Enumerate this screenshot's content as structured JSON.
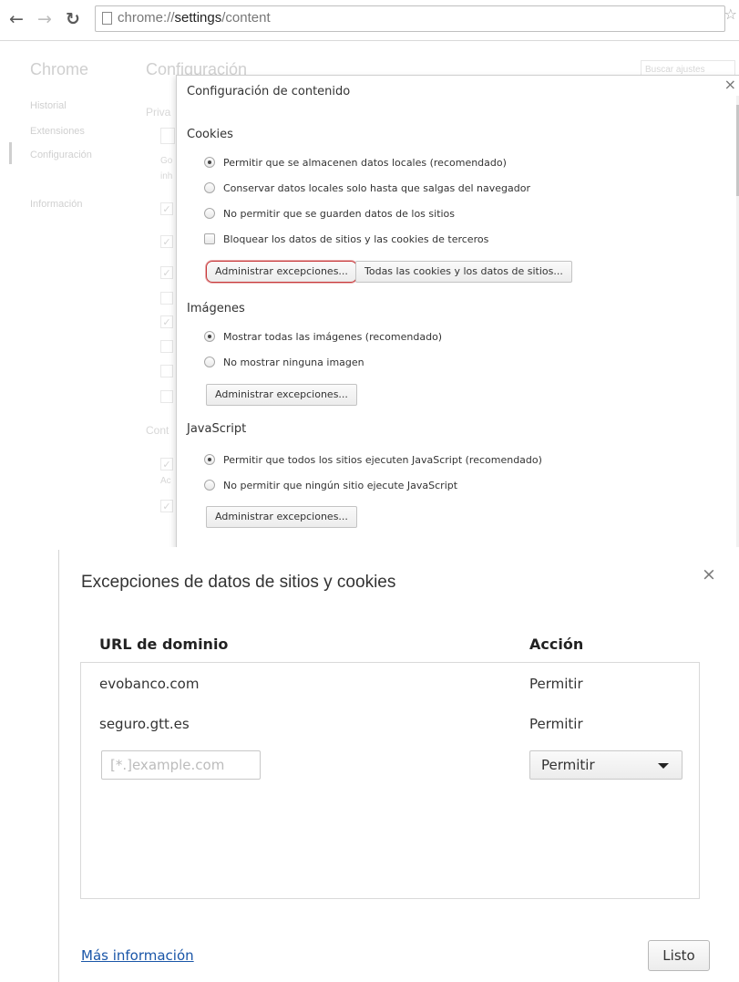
{
  "browser": {
    "url_prefix": "chrome://",
    "url_host": "settings",
    "url_path": "/content",
    "back_icon": "arrow-left-icon",
    "forward_icon": "arrow-right-icon",
    "reload_icon": "reload-icon",
    "star_icon": "star-icon"
  },
  "background_page": {
    "sidebar_title": "Chrome",
    "sidebar_items": [
      "Historial",
      "Extensiones",
      "Configuración",
      "Información"
    ],
    "main_title": "Configuración",
    "search_placeholder": "Buscar ajustes",
    "partial_labels": [
      "Priva",
      "Go",
      "inh",
      "Cont",
      "Ac"
    ]
  },
  "content_dialog": {
    "title": "Configuración de contenido",
    "close_icon": "close-icon",
    "cookies": {
      "heading": "Cookies",
      "options": [
        {
          "label": "Permitir que se almacenen datos locales (recomendado)",
          "selected": true
        },
        {
          "label": "Conservar datos locales solo hasta que salgas del navegador",
          "selected": false
        },
        {
          "label": "No permitir que se guarden datos de los sitios",
          "selected": false
        }
      ],
      "block_third_party": {
        "label": "Bloquear los datos de sitios y las cookies de terceros",
        "checked": false
      },
      "manage_button": "Administrar excepciones...",
      "all_cookies_button": "Todas las cookies y los datos de sitios..."
    },
    "images": {
      "heading": "Imágenes",
      "options": [
        {
          "label": "Mostrar todas las imágenes (recomendado)",
          "selected": true
        },
        {
          "label": "No mostrar ninguna imagen",
          "selected": false
        }
      ],
      "manage_button": "Administrar excepciones..."
    },
    "javascript": {
      "heading": "JavaScript",
      "options": [
        {
          "label": "Permitir que todos los sitios ejecuten JavaScript (recomendado)",
          "selected": true
        },
        {
          "label": "No permitir que ningún sitio ejecute JavaScript",
          "selected": false
        }
      ],
      "manage_button": "Administrar excepciones..."
    }
  },
  "exceptions_dialog": {
    "title": "Excepciones de datos de sitios y cookies",
    "close_icon": "close-icon",
    "columns": {
      "domain": "URL de dominio",
      "action": "Acción"
    },
    "rows": [
      {
        "domain": "evobanco.com",
        "action": "Permitir"
      },
      {
        "domain": "seguro.gtt.es",
        "action": "Permitir"
      }
    ],
    "new_entry": {
      "placeholder": "[*.]example.com",
      "value": "",
      "action_selected": "Permitir"
    },
    "more_info_link": "Más información",
    "done_button": "Listo"
  },
  "colors": {
    "highlight_border": "#c8383a",
    "link": "#1a56a8"
  }
}
